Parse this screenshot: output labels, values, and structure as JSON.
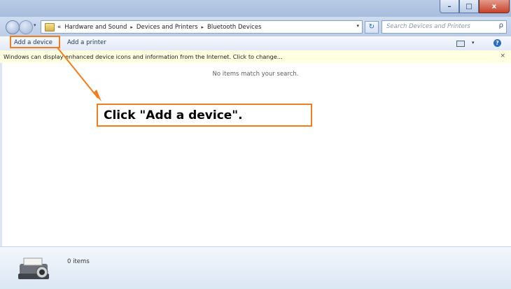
{
  "window": {
    "minimize": "–",
    "maximize": "□",
    "close": "x"
  },
  "address": {
    "overflow": "«",
    "breadcrumbs": [
      "Hardware and Sound",
      "Devices and Printers",
      "Bluetooth Devices"
    ],
    "separator": "▸",
    "dropdown": "▾",
    "refresh": "↻"
  },
  "search": {
    "placeholder": "Search Devices and Printers",
    "icon": "ρ"
  },
  "toolbar": {
    "add_device": "Add a device",
    "add_printer": "Add a printer",
    "view_dropdown": "▾",
    "help": "?"
  },
  "infobar": {
    "message": "Windows can display enhanced device icons and information from the Internet. Click to change...",
    "close": "×"
  },
  "content": {
    "empty_message": "No items match your search."
  },
  "annotation": {
    "text": "Click \"Add a device\".",
    "color": "#f07d1e"
  },
  "details": {
    "count": "0 items"
  }
}
